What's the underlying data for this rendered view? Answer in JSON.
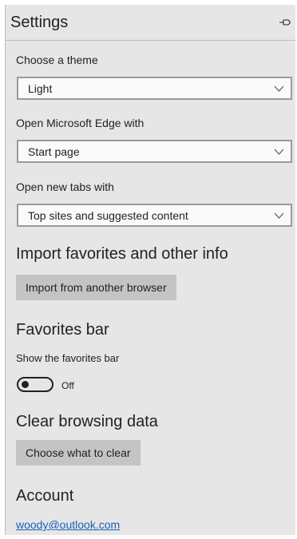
{
  "settings": {
    "title": "Settings",
    "theme_label": "Choose a theme",
    "theme_value": "Light",
    "open_with_label": "Open Microsoft Edge with",
    "open_with_value": "Start page",
    "new_tabs_label": "Open new tabs with",
    "new_tabs_value": "Top sites and suggested content",
    "import_heading": "Import favorites and other info",
    "import_button": "Import from another browser",
    "favorites_heading": "Favorites bar",
    "show_favorites_label": "Show the favorites bar",
    "toggle_state": "Off",
    "clear_heading": "Clear browsing data",
    "clear_button": "Choose what to clear",
    "account_heading": "Account",
    "account_email": "woody@outlook.com"
  },
  "icons": {
    "pin": "pin-icon",
    "dropdown": "chevron-down-icon"
  },
  "colors": {
    "panel_bg": "#e6e6e6",
    "button_bg": "#c4c4c4",
    "link": "#1a5fb4"
  }
}
